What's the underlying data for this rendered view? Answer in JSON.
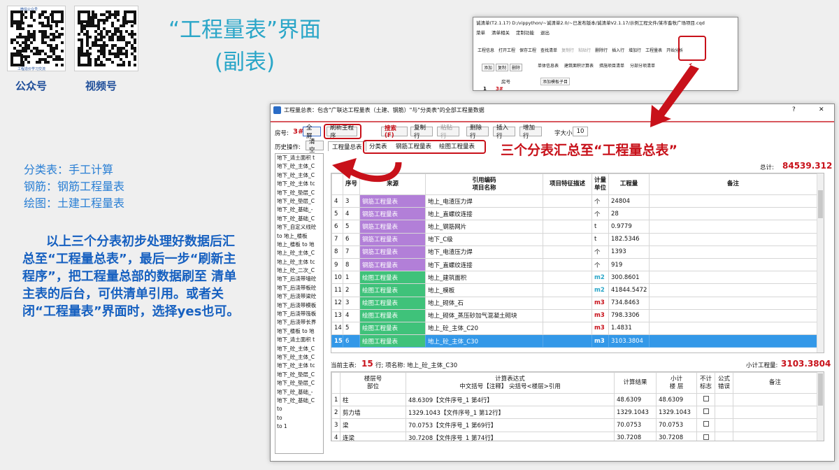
{
  "qr": {
    "label_left": "公众号",
    "label_right": "视频号",
    "top_text": "微信公众号",
    "bottom_text": "工程造价学习交流"
  },
  "slide": {
    "title_line1": "“工程量表”界面",
    "title_line2": "(副表)"
  },
  "notes": {
    "lines": [
      "分类表：手工计算",
      "钢筋：钢筋工程量表",
      "绘图：土建工程量表"
    ],
    "big": "以上三个分表初步处理好数据后汇总至“工程量总表”，最后一步“刷新主程序”，把工程量总部的数据刷至 清单主表的后台，可供清单引用。或者关闭“工程量表”界面时，选择yes也可。"
  },
  "callout": "三个分表汇总至“工程量总表”",
  "bg_window": {
    "title": "诚清单(T2.1.17)   D:/vippython/~诚清单2.0/~已发布版本/诚清单V2.1.17/示例工程文件/某市畜牧广场项目.cqd",
    "menu": [
      "菜单",
      "清单相关",
      "定制功能",
      "退出"
    ],
    "tools": [
      "工程信息",
      "打开工程",
      "保存工程",
      "查找清单",
      "复制行",
      "粘贴行",
      "删除行",
      "插入行",
      "增加行",
      "工程量表",
      "开始分析"
    ],
    "left_buttons": [
      "添加",
      "复制",
      "删除"
    ],
    "tabs": [
      "单体信息表",
      "建筑面积计算表",
      "措施项目清单",
      "分部分项清单"
    ],
    "sub_tab": "添加模板子目",
    "col_header": "房号",
    "row_num": "1",
    "row_val": "3#"
  },
  "main_window": {
    "title": "工程量总表：包含\"广联达工程量表（土建、钢筋）\"与\"分类表\"的全部工程量数据",
    "help": "?",
    "close": "✕",
    "fanghao_label": "房号:",
    "fanghao_value": "3#",
    "buttons": {
      "fullscreen": "全屏",
      "refresh": "刷新主程序",
      "search": "搜索 (F)",
      "copy": "复制行",
      "paste": "粘贴行",
      "delete": "删除行",
      "insert": "插入行",
      "add": "增加行",
      "fontsize_label": "字大小",
      "fontsize_value": "10"
    },
    "history_label": "历史操作:",
    "clear": "清空",
    "tabs": [
      "工程量总表",
      "分类表",
      "钢筋工程量表",
      "绘图工程量表"
    ],
    "total_label": "总计:",
    "total_value": "84539.312",
    "history": [
      "地下_清土面积 t",
      "地下_砼_主体_C",
      "地下_砼_主体_C",
      "地下_砼_主体 tc",
      "地下_砼_垫层_C",
      "地下_砼_垫层_C",
      "地下_砼_基础_-",
      "地下_砼_基础_C",
      "地下_自定义线砼",
      "to 地上_楼板",
      "地上_楼板 to 地",
      "地上_砼_主体_C",
      "地上_砼_主体 tc",
      "地上_砼_二次_C",
      "地下_后浇带墙砼",
      "地下_后浇带板砼",
      "地下_后浇带梁砼",
      "地下_后浇带模板",
      "地下_后浇带筏板",
      "地下_后浇带长界",
      "地下_楼板 to 地",
      "地下_清土面积 t",
      "地下_砼_主体_C",
      "地下_砼_主体_C",
      "地下_砼_主体 tc",
      "地下_砼_垫层_C",
      "地下_砼_垫层_C",
      "地下_砼_基础_-",
      "地下_砼_基础_C",
      "to",
      "to",
      "to 1"
    ],
    "headers": [
      "序号",
      "来源",
      "引用编码\n项目名称",
      "项目特征描述",
      "计量\n单位",
      "工程量",
      "备注"
    ],
    "rows": [
      {
        "n": "4",
        "seq": "3",
        "src": "钢筋工程量表",
        "name": "地上_电渣压力焊",
        "unit": "个",
        "qty": "24804"
      },
      {
        "n": "5",
        "seq": "4",
        "src": "钢筋工程量表",
        "name": "地上_直螺纹连接",
        "unit": "个",
        "qty": "28"
      },
      {
        "n": "6",
        "seq": "5",
        "src": "钢筋工程量表",
        "name": "地上_钢筋网片",
        "unit": "t",
        "qty": "0.9779"
      },
      {
        "n": "7",
        "seq": "6",
        "src": "钢筋工程量表",
        "name": "地下_C级",
        "unit": "t",
        "qty": "182.5346"
      },
      {
        "n": "8",
        "seq": "7",
        "src": "钢筋工程量表",
        "name": "地下_电渣压力焊",
        "unit": "个",
        "qty": "1393"
      },
      {
        "n": "9",
        "seq": "8",
        "src": "钢筋工程量表",
        "name": "地下_直螺纹连接",
        "unit": "个",
        "qty": "919"
      },
      {
        "n": "10",
        "seq": "1",
        "src": "绘图工程量表",
        "name": "地上_建筑面积",
        "unit": "m2",
        "qty": "300.8601"
      },
      {
        "n": "11",
        "seq": "2",
        "src": "绘图工程量表",
        "name": "地上_模板",
        "unit": "m2",
        "qty": "41844.5472"
      },
      {
        "n": "12",
        "seq": "3",
        "src": "绘图工程量表",
        "name": "地上_砌体_石",
        "unit": "m3",
        "qty": "734.8463"
      },
      {
        "n": "13",
        "seq": "4",
        "src": "绘图工程量表",
        "name": "地上_砌体_蒸压砂加气混凝土砌块",
        "unit": "m3",
        "qty": "798.3306"
      },
      {
        "n": "14",
        "seq": "5",
        "src": "绘图工程量表",
        "name": "地上_砼_主体_C20",
        "unit": "m3",
        "qty": "1.4831"
      },
      {
        "n": "15",
        "seq": "6",
        "src": "绘图工程量表",
        "name": "地上_砼_主体_C30",
        "unit": "m3",
        "qty": "3103.3804"
      }
    ],
    "current_label": "当前主表:",
    "current_row": "15",
    "current_mid": "行; 项名称: 地上_砼_主体_C30",
    "subtotal_label": "小计工程量:",
    "subtotal_value": "3103.3804",
    "detail_headers": [
      "楼层号\n部位",
      "计算表达式\n中文括号【注释】  尖括号<楼层>引用",
      "计算结果",
      "小计\n楼 层",
      "不计\n标志",
      "公式\n错误",
      "备注"
    ],
    "detail_rows": [
      {
        "n": "1",
        "part": "柱",
        "expr": "48.6309【文件序号_1 第4行】",
        "res": "48.6309",
        "sub": "48.6309"
      },
      {
        "n": "2",
        "part": "剪力墙",
        "expr": "1329.1043【文件序号_1 第12行】",
        "res": "1329.1043",
        "sub": "1329.1043"
      },
      {
        "n": "3",
        "part": "梁",
        "expr": "70.0753【文件序号_1 第69行】",
        "res": "70.0753",
        "sub": "70.0753"
      },
      {
        "n": "4",
        "part": "连梁",
        "expr": "30.7208【文件序号_1 第74行】",
        "res": "30.7208",
        "sub": "30.7208"
      }
    ]
  },
  "colors": {
    "purple": "#b27fd8",
    "green": "#3fc27a",
    "red": "#c8111a",
    "blue": "#2aa6c8",
    "select": "#3398e8"
  }
}
